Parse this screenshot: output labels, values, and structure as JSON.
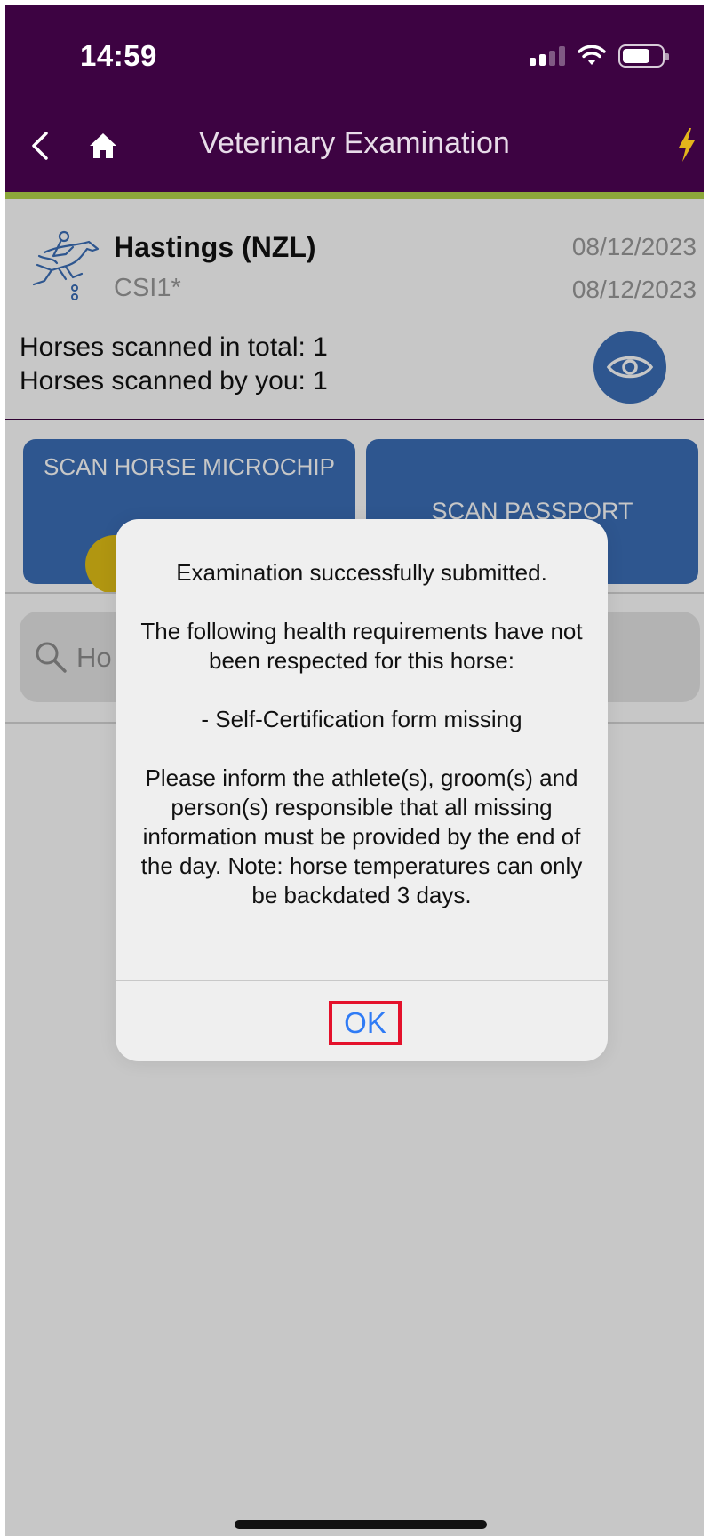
{
  "status_bar": {
    "time": "14:59",
    "icons": [
      "signal-icon",
      "wifi-icon",
      "battery-icon"
    ]
  },
  "nav": {
    "title": "Veterinary Examination",
    "icons": [
      "back-chevron-icon",
      "home-icon",
      "lightning-bolt-icon"
    ]
  },
  "event": {
    "name": "Hastings (NZL)",
    "level": "CSI1*",
    "start_date": "08/12/2023",
    "end_date": "08/12/2023",
    "horses_total": "Horses scanned in total: 1",
    "horses_by_you": "Horses scanned by you: 1"
  },
  "actions": {
    "scan_chip_label": "SCAN HORSE MICROCHIP",
    "scan_passport_label": "SCAN PASSPORT"
  },
  "search": {
    "placeholder_visible": "Ho"
  },
  "alert": {
    "title": "Examination successfully submitted.",
    "paragraph1": "The following health requirements have not been respected for this horse:",
    "paragraph2": "- Self-Certification form missing",
    "paragraph3": "Please inform the athlete(s), groom(s) and person(s) responsible that all missing information must be provided by the end of the day. Note: horse temperatures can only be backdated 3 days.",
    "ok_label": "OK"
  },
  "colors": {
    "header": "#3d0342",
    "accent_bar": "#8ca73a",
    "primary_button": "#3b6fb8",
    "pill": "#e3c117",
    "highlight_box": "#e4112b",
    "link": "#2f7bf5"
  }
}
